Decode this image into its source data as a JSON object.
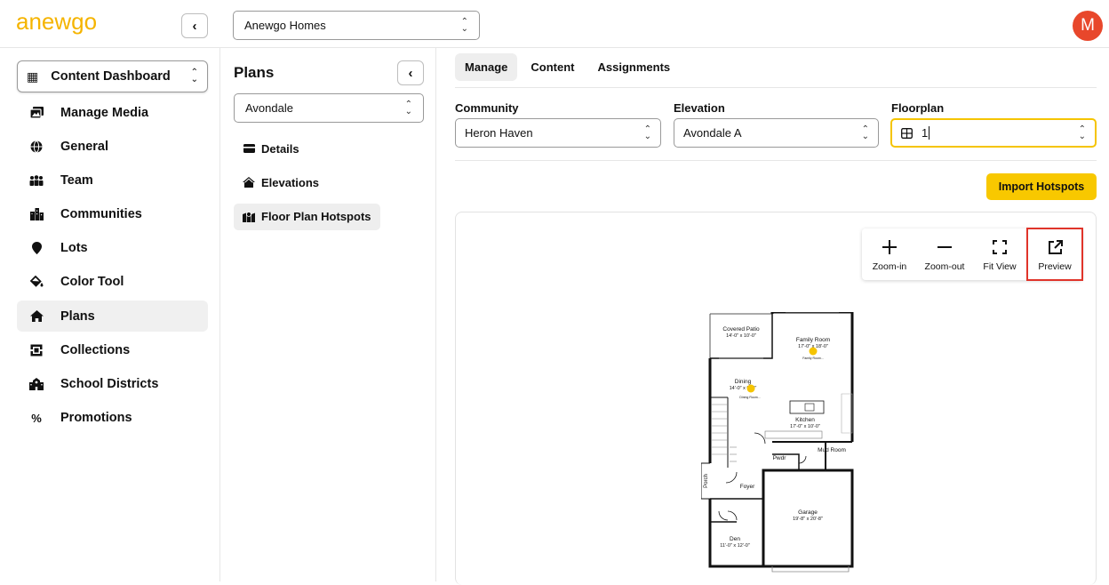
{
  "header": {
    "logo_text": "anewgo",
    "company": "Anewgo Homes",
    "avatar_letter": "M"
  },
  "sidebar": {
    "dashboard_label": "Content Dashboard",
    "items": [
      {
        "label": "Manage Media",
        "icon": "media-icon"
      },
      {
        "label": "General",
        "icon": "globe-icon"
      },
      {
        "label": "Team",
        "icon": "team-icon"
      },
      {
        "label": "Communities",
        "icon": "city-icon"
      },
      {
        "label": "Lots",
        "icon": "pin-icon"
      },
      {
        "label": "Color Tool",
        "icon": "paint-bucket-icon"
      },
      {
        "label": "Plans",
        "icon": "home-icon",
        "active": true
      },
      {
        "label": "Collections",
        "icon": "collections-icon"
      },
      {
        "label": "School Districts",
        "icon": "school-icon"
      },
      {
        "label": "Promotions",
        "icon": "percent-icon"
      }
    ]
  },
  "plans": {
    "title": "Plans",
    "selected_plan": "Avondale",
    "nav": [
      {
        "label": "Details",
        "icon": "card-icon"
      },
      {
        "label": "Elevations",
        "icon": "house-icon"
      },
      {
        "label": "Floor Plan Hotspots",
        "icon": "map-icon",
        "active": true
      }
    ]
  },
  "main": {
    "tabs": [
      {
        "label": "Manage",
        "active": true
      },
      {
        "label": "Content"
      },
      {
        "label": "Assignments"
      }
    ],
    "community_label": "Community",
    "community_value": "Heron Haven",
    "elevation_label": "Elevation",
    "elevation_value": "Avondale A",
    "floorplan_label": "Floorplan",
    "floorplan_value": "1",
    "import_button": "Import Hotspots",
    "tools": [
      {
        "label": "Zoom-in",
        "icon": "plus-icon"
      },
      {
        "label": "Zoom-out",
        "icon": "minus-icon"
      },
      {
        "label": "Fit View",
        "icon": "fit-view-icon"
      },
      {
        "label": "Preview",
        "icon": "external-link-icon"
      }
    ]
  },
  "floorplan": {
    "rooms": [
      {
        "name": "Covered Patio",
        "dims": "14'-0\" x 10'-0\""
      },
      {
        "name": "Family Room",
        "dims": "17'-0\" x 18'-0\""
      },
      {
        "name": "Dining",
        "dims": "14'-0\" x 9'-9\""
      },
      {
        "name": "Kitchen",
        "dims": "17'-0\" x 10'-0\""
      },
      {
        "name": "Pwdr",
        "dims": ""
      },
      {
        "name": "Mud Room",
        "dims": ""
      },
      {
        "name": "Porch",
        "dims": ""
      },
      {
        "name": "Foyer",
        "dims": ""
      },
      {
        "name": "Garage",
        "dims": "19'-8\" x 20'-8\""
      },
      {
        "name": "Den",
        "dims": "11'-0\" x 12'-0\""
      }
    ],
    "hotspot_labels": [
      "Family Room...",
      "Dining Room..."
    ],
    "hotspot_color": "#f5c400"
  },
  "colors": {
    "accent": "#f8c800",
    "avatar": "#e8472b",
    "highlight": "#e0342a"
  }
}
